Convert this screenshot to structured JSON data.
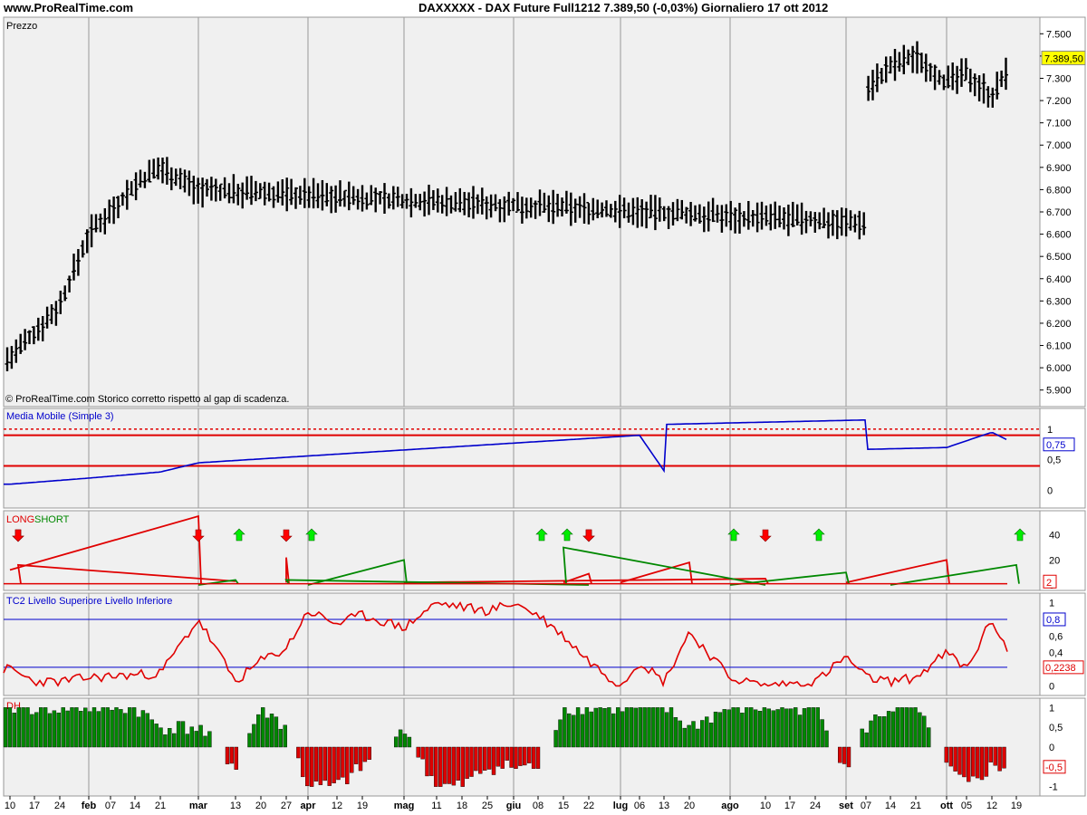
{
  "header": {
    "site": "www.ProRealTime.com",
    "title": "DAXXXXX - DAX Future Full1212   7.389,50 (-0,03%)   Giornaliero  17 ott 2012"
  },
  "colors": {
    "panel_bg": "#f0f0f0",
    "price_line": "#000000",
    "ma_line": "#0000cc",
    "long_line": "#e00000",
    "short_line": "#008800",
    "histo_pos": "#008800",
    "histo_neg": "#dd0000",
    "last_price_tag": "#ffff00"
  },
  "x_axis": {
    "ticks": [
      "10",
      "17",
      "24",
      "feb",
      "07",
      "14",
      "21",
      "mar",
      "13",
      "20",
      "27",
      "apr",
      "12",
      "19",
      "mag",
      "11",
      "18",
      "25",
      "giu",
      "08",
      "15",
      "22",
      "lug",
      "06",
      "13",
      "20",
      "ago",
      "10",
      "17",
      "24",
      "set",
      "07",
      "14",
      "21",
      "ott",
      "05",
      "12",
      "19"
    ]
  },
  "chart_data": [
    {
      "type": "bar",
      "subtype": "ohlc",
      "panel": "price",
      "title": "Prezzo",
      "note": "© ProRealTime.com Storico corretto rispetto al gap di scadenza.",
      "ylim": [
        5850,
        7550
      ],
      "yticks": [
        "7.500",
        "7.400",
        "7.300",
        "7.200",
        "7.100",
        "7.000",
        "6.900",
        "6.800",
        "6.700",
        "6.600",
        "6.500",
        "6.400",
        "6.300",
        "6.200",
        "6.100",
        "6.000",
        "5.900"
      ],
      "last_label": "7.389,50",
      "keypoints": [
        [
          "10",
          6040
        ],
        [
          "24",
          6280
        ],
        [
          "feb",
          6600
        ],
        [
          "14",
          6820
        ],
        [
          "21",
          6900
        ],
        [
          "mar",
          6800
        ],
        [
          "07",
          6650
        ],
        [
          "13",
          6900
        ],
        [
          "16",
          7150
        ],
        [
          "20",
          7060
        ],
        [
          "27",
          6950
        ],
        [
          "apr",
          7050
        ],
        [
          "12",
          6700
        ],
        [
          "19",
          6650
        ],
        [
          "mag",
          6750
        ],
        [
          "11",
          6450
        ],
        [
          "18",
          6300
        ],
        [
          "25",
          6380
        ],
        [
          "giu",
          6100
        ],
        [
          "08",
          6200
        ],
        [
          "15",
          6400
        ],
        [
          "22",
          6300
        ],
        [
          "lug",
          6500
        ],
        [
          "06",
          6450
        ],
        [
          "13",
          6600
        ],
        [
          "20",
          6700
        ],
        [
          "23",
          6350
        ],
        [
          "ago",
          6750
        ],
        [
          "10",
          6900
        ],
        [
          "17",
          6950
        ],
        [
          "24",
          6920
        ],
        [
          "set",
          6980
        ],
        [
          "07",
          7250
        ],
        [
          "14",
          7350
        ],
        [
          "21",
          7400
        ],
        [
          "ott",
          7280
        ],
        [
          "05",
          7320
        ],
        [
          "12",
          7220
        ],
        [
          "19",
          7390
        ]
      ]
    },
    {
      "type": "line",
      "panel": "ma",
      "title": "Media Mobile (Simple 3)",
      "ylim": [
        -0.2,
        1.25
      ],
      "yticks": [
        "1",
        "0,5",
        "0"
      ],
      "levels": [
        0.4,
        0.9
      ],
      "dotted_level": 1.0,
      "last_label": "0,75",
      "keypoints": [
        [
          "10",
          0.1
        ],
        [
          "feb",
          0.2
        ],
        [
          "21",
          0.3
        ],
        [
          "mar",
          0.45
        ],
        [
          "06",
          0.9
        ],
        [
          "13",
          0.32
        ],
        [
          "27",
          0.9
        ],
        [
          "apr",
          0.95
        ],
        [
          "07",
          1.15
        ],
        [
          "mag",
          0.7
        ],
        [
          "18",
          0.7
        ],
        [
          "25",
          0.6
        ],
        [
          "giu",
          1.05
        ],
        [
          "15",
          0.3
        ],
        [
          "20",
          -0.15
        ],
        [
          "27",
          0.15
        ],
        [
          "lug",
          0.0
        ],
        [
          "20",
          0.2
        ],
        [
          "27",
          0.55
        ],
        [
          "ago",
          0.3
        ],
        [
          "17",
          0.3
        ],
        [
          "31",
          0.5
        ],
        [
          "07",
          0.5
        ],
        [
          "14",
          0.35
        ],
        [
          "21",
          0.4
        ],
        [
          "ott",
          0.7
        ],
        [
          "12",
          0.95
        ],
        [
          "19",
          0.75
        ]
      ]
    },
    {
      "type": "line",
      "panel": "signals",
      "title_long": "LONG",
      "title_short": "SHORT",
      "ylim": [
        0,
        55
      ],
      "yticks": [
        "40",
        "20",
        "0"
      ],
      "last_label": "2",
      "long_segments": [
        [
          "10",
          12,
          "mar",
          55
        ],
        [
          "13",
          3,
          "30",
          16
        ],
        [
          "mag",
          2,
          "10",
          5
        ],
        [
          "15",
          2,
          "22",
          9
        ],
        [
          "lug",
          2,
          "20",
          18
        ],
        [
          "27",
          2,
          "27",
          22
        ],
        [
          "set",
          2,
          "ott",
          20
        ]
      ],
      "short_segments": [
        [
          "mar",
          0,
          "13",
          4
        ],
        [
          "apr",
          0,
          "mag",
          20
        ],
        [
          "10",
          0,
          "15",
          30
        ],
        [
          "22",
          0,
          "27",
          4
        ],
        [
          "ago",
          0,
          "set",
          10
        ],
        [
          "14",
          0,
          "19",
          16
        ]
      ],
      "down_arrows": [
        "mar",
        "30",
        "10",
        "22",
        "22",
        "28",
        "27"
      ],
      "up_arrows": [
        "13",
        "apr",
        "15",
        "24",
        "ago",
        "08",
        "19"
      ]
    },
    {
      "type": "line",
      "panel": "tc2",
      "title": "TC2 Livello Superiore Livello Inferiore",
      "ylim": [
        -0.05,
        1.05
      ],
      "yticks": [
        "1",
        "0,8",
        "0,6",
        "0,4",
        "0,2",
        "0"
      ],
      "upper_level": 0.8,
      "lower_level": 0.2238,
      "last_label_upper": "0,8",
      "last_label_lower": "0,2238",
      "keypoints": [
        [
          "10",
          0.2
        ],
        [
          "17",
          0.05
        ],
        [
          "24",
          0.05
        ],
        [
          "feb",
          0.1
        ],
        [
          "21",
          0.15
        ],
        [
          "mar",
          0.8
        ],
        [
          "13",
          0.05
        ],
        [
          "20",
          0.3
        ],
        [
          "27",
          0.45
        ],
        [
          "apr",
          0.9
        ],
        [
          "12",
          0.75
        ],
        [
          "19",
          0.85
        ],
        [
          "mag",
          0.7
        ],
        [
          "11",
          1.0
        ],
        [
          "25",
          0.9
        ],
        [
          "giu",
          1.0
        ],
        [
          "08",
          0.85
        ],
        [
          "15",
          0.6
        ],
        [
          "22",
          0.3
        ],
        [
          "lug",
          0.0
        ],
        [
          "06",
          0.3
        ],
        [
          "13",
          0.05
        ],
        [
          "20",
          0.65
        ],
        [
          "ago",
          0.1
        ],
        [
          "10",
          0.0
        ],
        [
          "24",
          0.05
        ],
        [
          "set",
          0.35
        ],
        [
          "07",
          0.1
        ],
        [
          "14",
          0.05
        ],
        [
          "21",
          0.1
        ],
        [
          "ott",
          0.4
        ],
        [
          "05",
          0.2
        ],
        [
          "12",
          0.8
        ],
        [
          "19",
          0.2238
        ]
      ]
    },
    {
      "type": "bar",
      "panel": "histogram",
      "title": "DH",
      "ylim": [
        -1.1,
        1.1
      ],
      "yticks": [
        "1",
        "0,5",
        "0",
        "-0,5",
        "-1"
      ],
      "last_label": "-0,5",
      "blocks": [
        [
          "10",
          1
        ],
        [
          "17",
          1
        ],
        [
          "24",
          1
        ],
        [
          "feb",
          1
        ],
        [
          "14",
          1
        ],
        [
          "21",
          0.5
        ],
        [
          "mar",
          0.5
        ],
        [
          "13",
          -0.5
        ],
        [
          "20",
          1
        ],
        [
          "27",
          0.5
        ],
        [
          "apr",
          -1
        ],
        [
          "12",
          -1
        ],
        [
          "19",
          -0.5
        ],
        [
          "mag",
          0.5
        ],
        [
          "11",
          -1
        ],
        [
          "18",
          -1
        ],
        [
          "25",
          -0.5
        ],
        [
          "giu",
          -0.5
        ],
        [
          "08",
          -0.5
        ],
        [
          "15",
          1
        ],
        [
          "22",
          1
        ],
        [
          "lug",
          1
        ],
        [
          "06",
          1
        ],
        [
          "13",
          1
        ],
        [
          "20",
          0.5
        ],
        [
          "ago",
          1
        ],
        [
          "10",
          1
        ],
        [
          "17",
          1
        ],
        [
          "24",
          1
        ],
        [
          "set",
          -0.5
        ],
        [
          "07",
          0.5
        ],
        [
          "14",
          1
        ],
        [
          "21",
          1
        ],
        [
          "ott",
          -0.5
        ],
        [
          "05",
          -1
        ],
        [
          "12",
          -0.5
        ],
        [
          "19",
          -0.5
        ]
      ]
    }
  ]
}
